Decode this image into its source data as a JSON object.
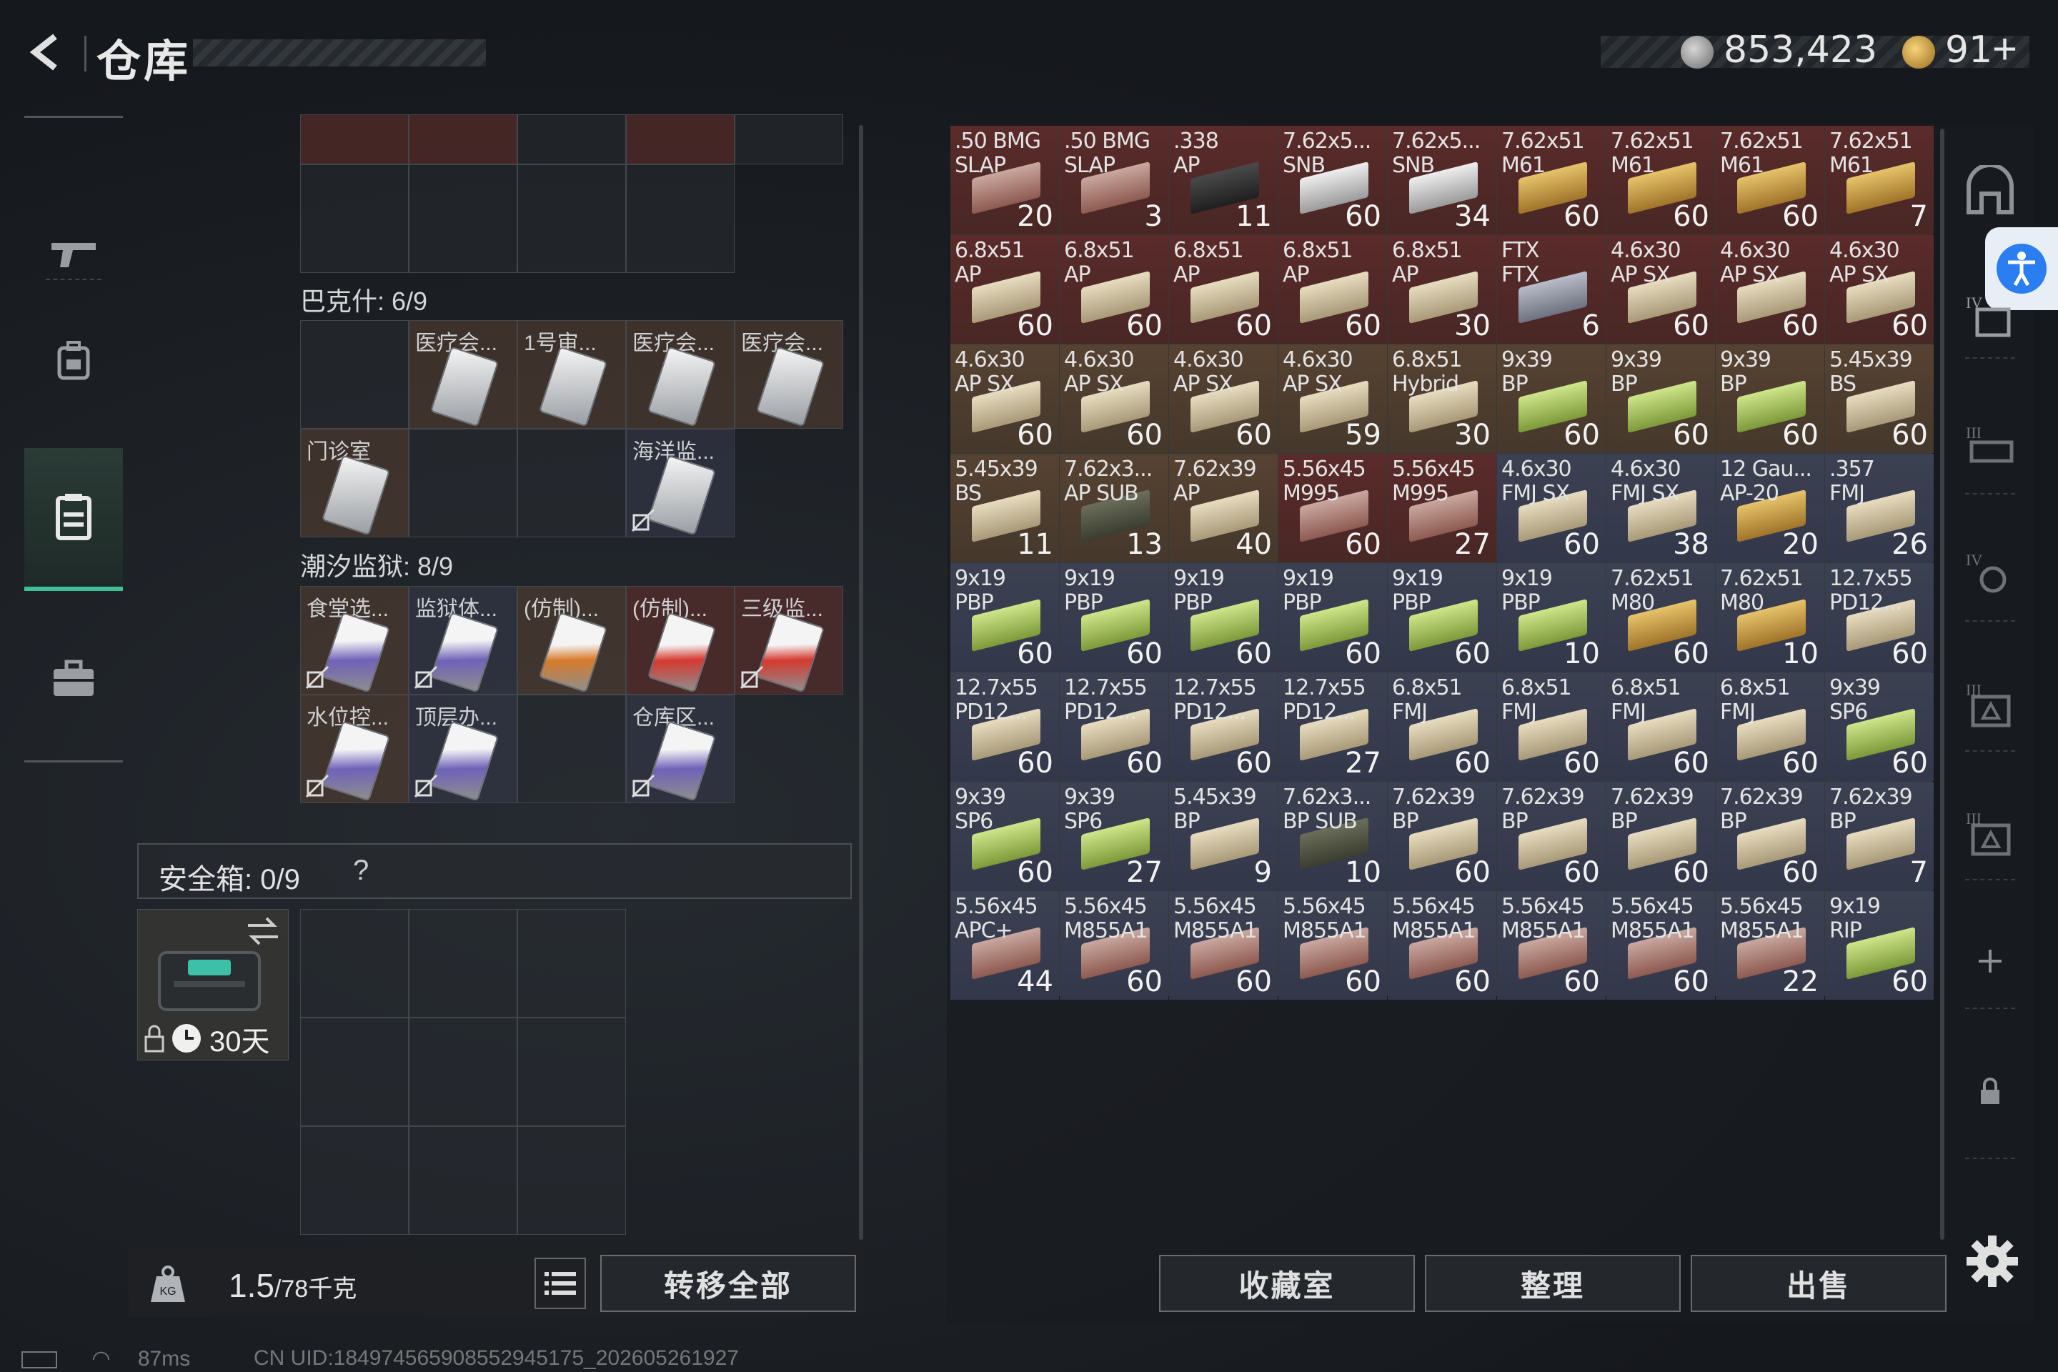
{
  "header": {
    "title": "仓库",
    "silver": "853,423",
    "gold": "91",
    "plus": "+"
  },
  "left": {
    "sections": [
      {
        "title": "巴克什: 6/9"
      },
      {
        "title": "潮汐监狱: 8/9"
      }
    ],
    "bakesh": [
      "医疗会...",
      "1号审...",
      "医疗会...",
      "医疗会...",
      "门诊室",
      "海洋监..."
    ],
    "tide": [
      "食堂选...",
      "监狱体...",
      "(仿制)...",
      "(仿制)...",
      "三级监...",
      "水位控...",
      "顶层办...",
      "仓库区..."
    ],
    "safe_title": "安全箱: 0/9",
    "safe_help": "?",
    "safebox_days": "30天",
    "weight_main": "1.5",
    "weight_rest": "/78千克",
    "transfer_all": "转移全部",
    "ping": "87ms",
    "uid": "CN UID:1849745659085529451​75_202605261927"
  },
  "grid_items": [
    {
      "l1": ".50 BMG",
      "l2": "SLAP",
      "q": "20",
      "c": "c-red",
      "a": "a-red"
    },
    {
      "l1": ".50 BMG",
      "l2": "SLAP",
      "q": "3",
      "c": "c-red",
      "a": "a-red"
    },
    {
      "l1": ".338",
      "l2": "AP",
      "q": "11",
      "c": "c-red",
      "a": "a-black"
    },
    {
      "l1": "7.62x5...",
      "l2": "SNB",
      "q": "60",
      "c": "c-red",
      "a": "a-white"
    },
    {
      "l1": "7.62x5...",
      "l2": "SNB",
      "q": "34",
      "c": "c-red",
      "a": "a-white"
    },
    {
      "l1": "7.62x51",
      "l2": "M61",
      "q": "60",
      "c": "c-red",
      "a": "a-yellow"
    },
    {
      "l1": "7.62x51",
      "l2": "M61",
      "q": "60",
      "c": "c-red",
      "a": "a-yellow"
    },
    {
      "l1": "7.62x51",
      "l2": "M61",
      "q": "60",
      "c": "c-red",
      "a": "a-yellow"
    },
    {
      "l1": "7.62x51",
      "l2": "M61",
      "q": "7",
      "c": "c-red",
      "a": "a-yellow"
    },
    {
      "l1": "6.8x51",
      "l2": "AP",
      "q": "60",
      "c": "c-red",
      "a": "a-tan"
    },
    {
      "l1": "6.8x51",
      "l2": "AP",
      "q": "60",
      "c": "c-red",
      "a": "a-tan"
    },
    {
      "l1": "6.8x51",
      "l2": "AP",
      "q": "60",
      "c": "c-red",
      "a": "a-tan"
    },
    {
      "l1": "6.8x51",
      "l2": "AP",
      "q": "60",
      "c": "c-red",
      "a": "a-tan"
    },
    {
      "l1": "6.8x51",
      "l2": "AP",
      "q": "30",
      "c": "c-red",
      "a": "a-tan"
    },
    {
      "l1": "FTX",
      "l2": "FTX",
      "q": "6",
      "c": "c-red",
      "a": "a-grey"
    },
    {
      "l1": "4.6x30",
      "l2": "AP SX",
      "q": "60",
      "c": "c-red",
      "a": "a-tan"
    },
    {
      "l1": "4.6x30",
      "l2": "AP SX",
      "q": "60",
      "c": "c-red",
      "a": "a-tan"
    },
    {
      "l1": "4.6x30",
      "l2": "AP SX",
      "q": "60",
      "c": "c-red",
      "a": "a-tan"
    },
    {
      "l1": "4.6x30",
      "l2": "AP SX",
      "q": "60",
      "c": "c-brown",
      "a": "a-tan"
    },
    {
      "l1": "4.6x30",
      "l2": "AP SX",
      "q": "60",
      "c": "c-brown",
      "a": "a-tan"
    },
    {
      "l1": "4.6x30",
      "l2": "AP SX",
      "q": "60",
      "c": "c-brown",
      "a": "a-tan"
    },
    {
      "l1": "4.6x30",
      "l2": "AP SX",
      "q": "59",
      "c": "c-brown",
      "a": "a-tan"
    },
    {
      "l1": "6.8x51",
      "l2": "Hybrid",
      "q": "30",
      "c": "c-brown",
      "a": "a-tan"
    },
    {
      "l1": "9x39",
      "l2": "BP",
      "q": "60",
      "c": "c-brown",
      "a": "a-lime"
    },
    {
      "l1": "9x39",
      "l2": "BP",
      "q": "60",
      "c": "c-brown",
      "a": "a-lime"
    },
    {
      "l1": "9x39",
      "l2": "BP",
      "q": "60",
      "c": "c-brown",
      "a": "a-lime"
    },
    {
      "l1": "5.45x39",
      "l2": "BS",
      "q": "60",
      "c": "c-brown",
      "a": "a-tan"
    },
    {
      "l1": "5.45x39",
      "l2": "BS",
      "q": "11",
      "c": "c-brown",
      "a": "a-tan"
    },
    {
      "l1": "7.62x3...",
      "l2": "AP SUB",
      "q": "13",
      "c": "c-brown",
      "a": "a-dark"
    },
    {
      "l1": "7.62x39",
      "l2": "AP",
      "q": "40",
      "c": "c-brown",
      "a": "a-tan"
    },
    {
      "l1": "5.56x45",
      "l2": "M995",
      "q": "60",
      "c": "c-red",
      "a": "a-red"
    },
    {
      "l1": "5.56x45",
      "l2": "M995",
      "q": "27",
      "c": "c-red",
      "a": "a-red"
    },
    {
      "l1": "4.6x30",
      "l2": "FMJ SX",
      "q": "60",
      "c": "c-blue",
      "a": "a-tan"
    },
    {
      "l1": "4.6x30",
      "l2": "FMJ SX",
      "q": "38",
      "c": "c-blue",
      "a": "a-tan"
    },
    {
      "l1": "12 Gau...",
      "l2": "AP-20",
      "q": "20",
      "c": "c-blue",
      "a": "a-yellow"
    },
    {
      "l1": ".357",
      "l2": "FMJ",
      "q": "26",
      "c": "c-blue",
      "a": "a-tan"
    },
    {
      "l1": "9x19",
      "l2": "PBP",
      "q": "60",
      "c": "c-blue",
      "a": "a-lime"
    },
    {
      "l1": "9x19",
      "l2": "PBP",
      "q": "60",
      "c": "c-blue",
      "a": "a-lime"
    },
    {
      "l1": "9x19",
      "l2": "PBP",
      "q": "60",
      "c": "c-blue",
      "a": "a-lime"
    },
    {
      "l1": "9x19",
      "l2": "PBP",
      "q": "60",
      "c": "c-blue",
      "a": "a-lime"
    },
    {
      "l1": "9x19",
      "l2": "PBP",
      "q": "60",
      "c": "c-blue",
      "a": "a-lime"
    },
    {
      "l1": "9x19",
      "l2": "PBP",
      "q": "10",
      "c": "c-blue",
      "a": "a-lime"
    },
    {
      "l1": "7.62x51",
      "l2": "M80",
      "q": "60",
      "c": "c-blue",
      "a": "a-yellow"
    },
    {
      "l1": "7.62x51",
      "l2": "M80",
      "q": "10",
      "c": "c-blue",
      "a": "a-yellow"
    },
    {
      "l1": "12.7x55",
      "l2": "PD12...",
      "q": "60",
      "c": "c-blue",
      "a": "a-tan"
    },
    {
      "l1": "12.7x55",
      "l2": "PD12...",
      "q": "60",
      "c": "c-blue",
      "a": "a-tan"
    },
    {
      "l1": "12.7x55",
      "l2": "PD12...",
      "q": "60",
      "c": "c-blue",
      "a": "a-tan"
    },
    {
      "l1": "12.7x55",
      "l2": "PD12...",
      "q": "60",
      "c": "c-blue",
      "a": "a-tan"
    },
    {
      "l1": "12.7x55",
      "l2": "PD12...",
      "q": "27",
      "c": "c-blue",
      "a": "a-tan"
    },
    {
      "l1": "6.8x51",
      "l2": "FMJ",
      "q": "60",
      "c": "c-blue",
      "a": "a-tan"
    },
    {
      "l1": "6.8x51",
      "l2": "FMJ",
      "q": "60",
      "c": "c-blue",
      "a": "a-tan"
    },
    {
      "l1": "6.8x51",
      "l2": "FMJ",
      "q": "60",
      "c": "c-blue",
      "a": "a-tan"
    },
    {
      "l1": "6.8x51",
      "l2": "FMJ",
      "q": "60",
      "c": "c-blue",
      "a": "a-tan"
    },
    {
      "l1": "9x39",
      "l2": "SP6",
      "q": "60",
      "c": "c-blue",
      "a": "a-lime"
    },
    {
      "l1": "9x39",
      "l2": "SP6",
      "q": "60",
      "c": "c-blue",
      "a": "a-lime"
    },
    {
      "l1": "9x39",
      "l2": "SP6",
      "q": "27",
      "c": "c-blue",
      "a": "a-lime"
    },
    {
      "l1": "5.45x39",
      "l2": "BP",
      "q": "9",
      "c": "c-blue",
      "a": "a-tan"
    },
    {
      "l1": "7.62x3...",
      "l2": "BP SUB",
      "q": "10",
      "c": "c-blue",
      "a": "a-dark"
    },
    {
      "l1": "7.62x39",
      "l2": "BP",
      "q": "60",
      "c": "c-blue",
      "a": "a-tan"
    },
    {
      "l1": "7.62x39",
      "l2": "BP",
      "q": "60",
      "c": "c-blue",
      "a": "a-tan"
    },
    {
      "l1": "7.62x39",
      "l2": "BP",
      "q": "60",
      "c": "c-blue",
      "a": "a-tan"
    },
    {
      "l1": "7.62x39",
      "l2": "BP",
      "q": "60",
      "c": "c-blue",
      "a": "a-tan"
    },
    {
      "l1": "7.62x39",
      "l2": "BP",
      "q": "7",
      "c": "c-blue",
      "a": "a-tan"
    },
    {
      "l1": "5.56x45",
      "l2": "APC+",
      "q": "44",
      "c": "c-blue",
      "a": "a-red"
    },
    {
      "l1": "5.56x45",
      "l2": "M855A1",
      "q": "60",
      "c": "c-blue",
      "a": "a-red"
    },
    {
      "l1": "5.56x45",
      "l2": "M855A1",
      "q": "60",
      "c": "c-blue",
      "a": "a-red"
    },
    {
      "l1": "5.56x45",
      "l2": "M855A1",
      "q": "60",
      "c": "c-blue",
      "a": "a-red"
    },
    {
      "l1": "5.56x45",
      "l2": "M855A1",
      "q": "60",
      "c": "c-blue",
      "a": "a-red"
    },
    {
      "l1": "5.56x45",
      "l2": "M855A1",
      "q": "60",
      "c": "c-blue",
      "a": "a-red"
    },
    {
      "l1": "5.56x45",
      "l2": "M855A1",
      "q": "60",
      "c": "c-blue",
      "a": "a-red"
    },
    {
      "l1": "5.56x45",
      "l2": "M855A1",
      "q": "22",
      "c": "c-blue",
      "a": "a-red"
    },
    {
      "l1": "9x19",
      "l2": "RIP",
      "q": "60",
      "c": "c-blue",
      "a": "a-lime"
    }
  ],
  "buttons": {
    "collection": "收藏室",
    "sort": "整理",
    "sell": "出售"
  },
  "icons": {
    "back": "back-arrow-icon",
    "silver": "silver-coin-icon",
    "gold": "gold-coin-icon",
    "nav": [
      "weapon-icon",
      "backpack-icon",
      "storage-icon",
      "briefcase-icon"
    ],
    "right": [
      "safehouse-icon",
      "accessibility-icon",
      "tier4-storage-icon",
      "tier3-storage-icon",
      "tier4-gear-icon",
      "tier3-case-icon",
      "tier3-box-icon",
      "add-icon",
      "lock-icon",
      "settings-icon"
    ]
  }
}
